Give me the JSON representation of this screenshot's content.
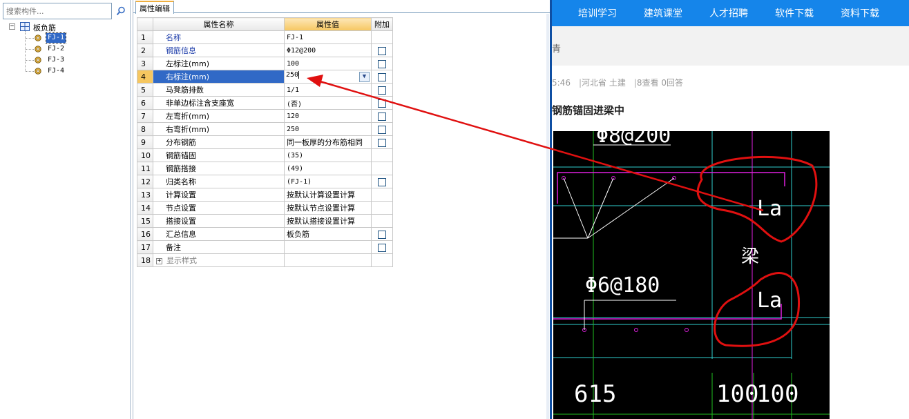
{
  "search": {
    "placeholder": "搜索构件..."
  },
  "tree": {
    "root_label": "板负筋",
    "toggle": "−",
    "children": [
      {
        "label": "FJ-1",
        "selected": true
      },
      {
        "label": "FJ-2"
      },
      {
        "label": "FJ-3"
      },
      {
        "label": "FJ-4"
      }
    ]
  },
  "properties": {
    "tab_label": "属性编辑",
    "headers": {
      "name": "属性名称",
      "value": "属性值",
      "extra": "附加"
    },
    "rows": [
      {
        "num": "1",
        "name": "名称",
        "value": "FJ-1",
        "blue": true,
        "check": false
      },
      {
        "num": "2",
        "name": "钢筋信息",
        "value": "Φ12@200",
        "blue": true,
        "check": true
      },
      {
        "num": "3",
        "name": "左标注(mm)",
        "value": "100",
        "check": true
      },
      {
        "num": "4",
        "name": "右标注(mm)",
        "value": "250",
        "check": true,
        "selected": true
      },
      {
        "num": "5",
        "name": "马凳筋排数",
        "value": "1/1",
        "check": true
      },
      {
        "num": "6",
        "name": "非单边标注含支座宽",
        "value": "(否)",
        "check": true
      },
      {
        "num": "7",
        "name": "左弯折(mm)",
        "value": "120",
        "check": true
      },
      {
        "num": "8",
        "name": "右弯折(mm)",
        "value": "250",
        "check": true
      },
      {
        "num": "9",
        "name": "分布钢筋",
        "value": "同一板厚的分布筋相同",
        "check": true,
        "cjk": true
      },
      {
        "num": "10",
        "name": "钢筋锚固",
        "value": "(35)",
        "check": false
      },
      {
        "num": "11",
        "name": "钢筋搭接",
        "value": "(49)",
        "check": false
      },
      {
        "num": "12",
        "name": "归类名称",
        "value": "(FJ-1)",
        "check": true
      },
      {
        "num": "13",
        "name": "计算设置",
        "value": "按默认计算设置计算",
        "check": false,
        "cjk": true
      },
      {
        "num": "14",
        "name": "节点设置",
        "value": "按默认节点设置计算",
        "check": false,
        "cjk": true
      },
      {
        "num": "15",
        "name": "搭接设置",
        "value": "按默认搭接设置计算",
        "check": false,
        "cjk": true
      },
      {
        "num": "16",
        "name": "汇总信息",
        "value": "板负筋",
        "check": true,
        "cjk": true
      },
      {
        "num": "17",
        "name": "备注",
        "value": "",
        "check": true
      },
      {
        "num": "18",
        "name": "显示样式",
        "value": "",
        "check": false,
        "expander": "+"
      }
    ]
  },
  "web": {
    "nav": [
      "培训学习",
      "建筑课堂",
      "人才招聘",
      "软件下载",
      "资料下载"
    ],
    "bar_glyph": "青",
    "meta": {
      "time": "5:46",
      "location": "河北省  土建",
      "views": "8查看",
      "answers": "0回答"
    },
    "title": "钢筋锚固进梁中",
    "cad_labels": {
      "top_rebar": "Φ8@200",
      "mid_rebar": "Φ6@180",
      "la_top": "La",
      "la_bottom": "La",
      "beam": "梁",
      "dim_615": "615",
      "dim_100a": "100",
      "dim_100b": "100"
    }
  },
  "colors": {
    "nav_blue": "#1585ea",
    "selection_blue": "#3169c6",
    "header_orange": "#f6c760",
    "annotation_red": "#e01010"
  }
}
